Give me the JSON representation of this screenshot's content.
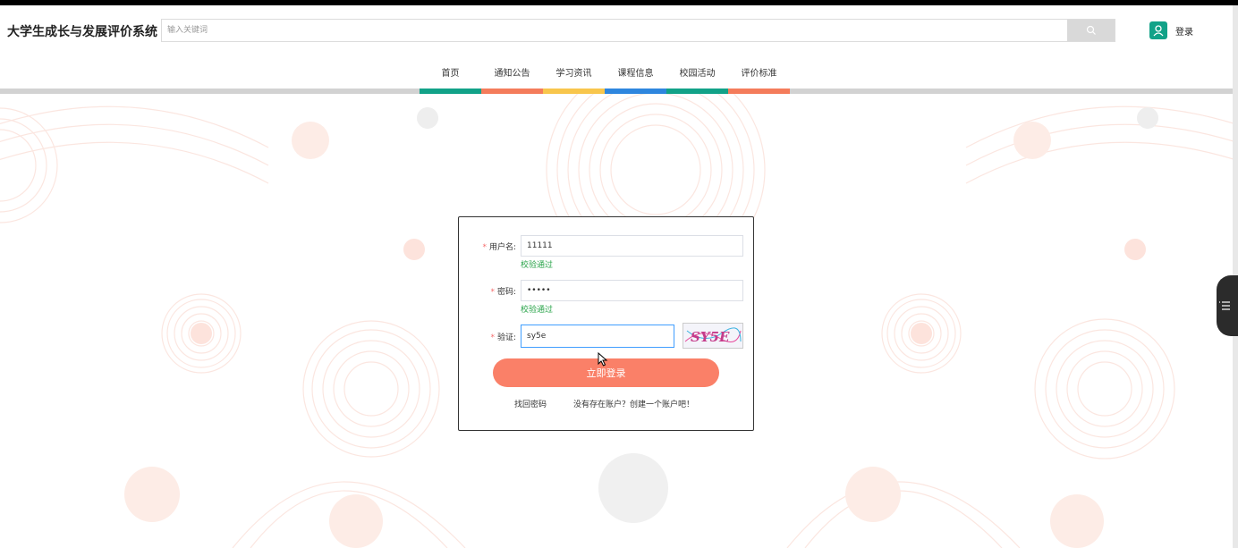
{
  "header": {
    "site_title": "大学生成长与发展评价系统",
    "search_placeholder": "输入关键词",
    "login_label": "登录"
  },
  "nav": {
    "items": [
      {
        "label": "首页",
        "color": "#12a288"
      },
      {
        "label": "通知公告",
        "color": "#f47c5b"
      },
      {
        "label": "学习资讯",
        "color": "#f8c64c"
      },
      {
        "label": "课程信息",
        "color": "#2e86de"
      },
      {
        "label": "校园活动",
        "color": "#12a288"
      },
      {
        "label": "评价标准",
        "color": "#f47c5b"
      }
    ]
  },
  "login_form": {
    "username_label": "用户名:",
    "username_value": "11111",
    "username_hint": "校验通过",
    "password_label": "密码:",
    "password_value": "•••••",
    "password_hint": "校验通过",
    "captcha_label": "验证:",
    "captcha_value": "sy5e",
    "captcha_image_text": "SY5E",
    "submit_label": "立即登录",
    "forgot_link": "找回密码",
    "register_link": "没有存在账户？创建一个账户吧！"
  },
  "colors": {
    "accent": "#fa8068",
    "brand": "#12a288",
    "valid": "#2aa44a"
  }
}
